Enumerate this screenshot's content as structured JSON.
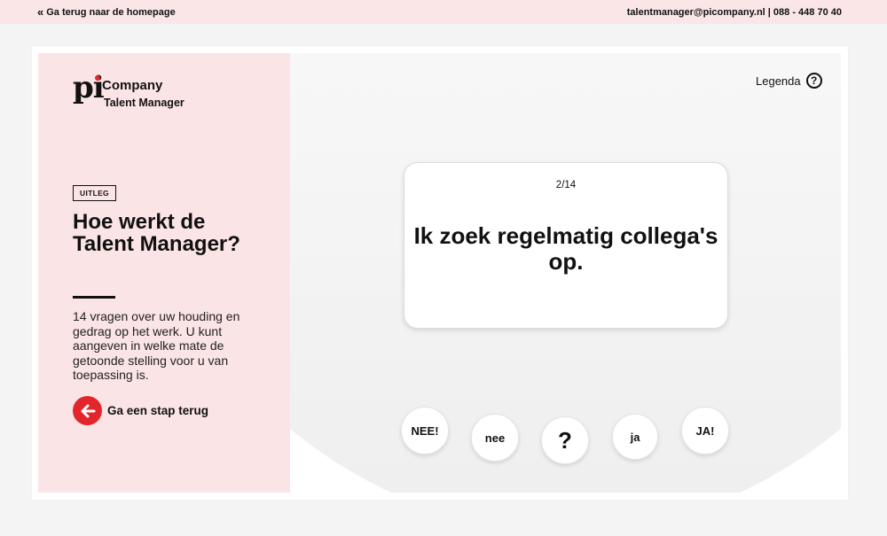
{
  "topbar": {
    "back_label": "Ga terug naar de homepage",
    "contact": "talentmanager@picompany.nl | 088 - 448 70 40"
  },
  "logo": {
    "pi": "pi",
    "company": "Company",
    "product": "Talent Manager"
  },
  "info": {
    "badge": "UITLEG",
    "title": "Hoe werkt de Talent Manager?",
    "description": "14 vragen over uw houding en gedrag op het werk. U kunt aangeven in welke mate de getoonde stelling voor u van toepassing is.",
    "back_step": "Ga een stap terug"
  },
  "legend": {
    "label": "Legenda",
    "icon": "question-circle-icon"
  },
  "question": {
    "counter": "2/14",
    "statement": "Ik zoek regelmatig collega's op."
  },
  "answers": [
    "NEE!",
    "nee",
    "?",
    "ja",
    "JA!"
  ],
  "colors": {
    "accent": "#e3262b",
    "panel": "#fbe4e5",
    "topbar": "#fbe6e7"
  }
}
